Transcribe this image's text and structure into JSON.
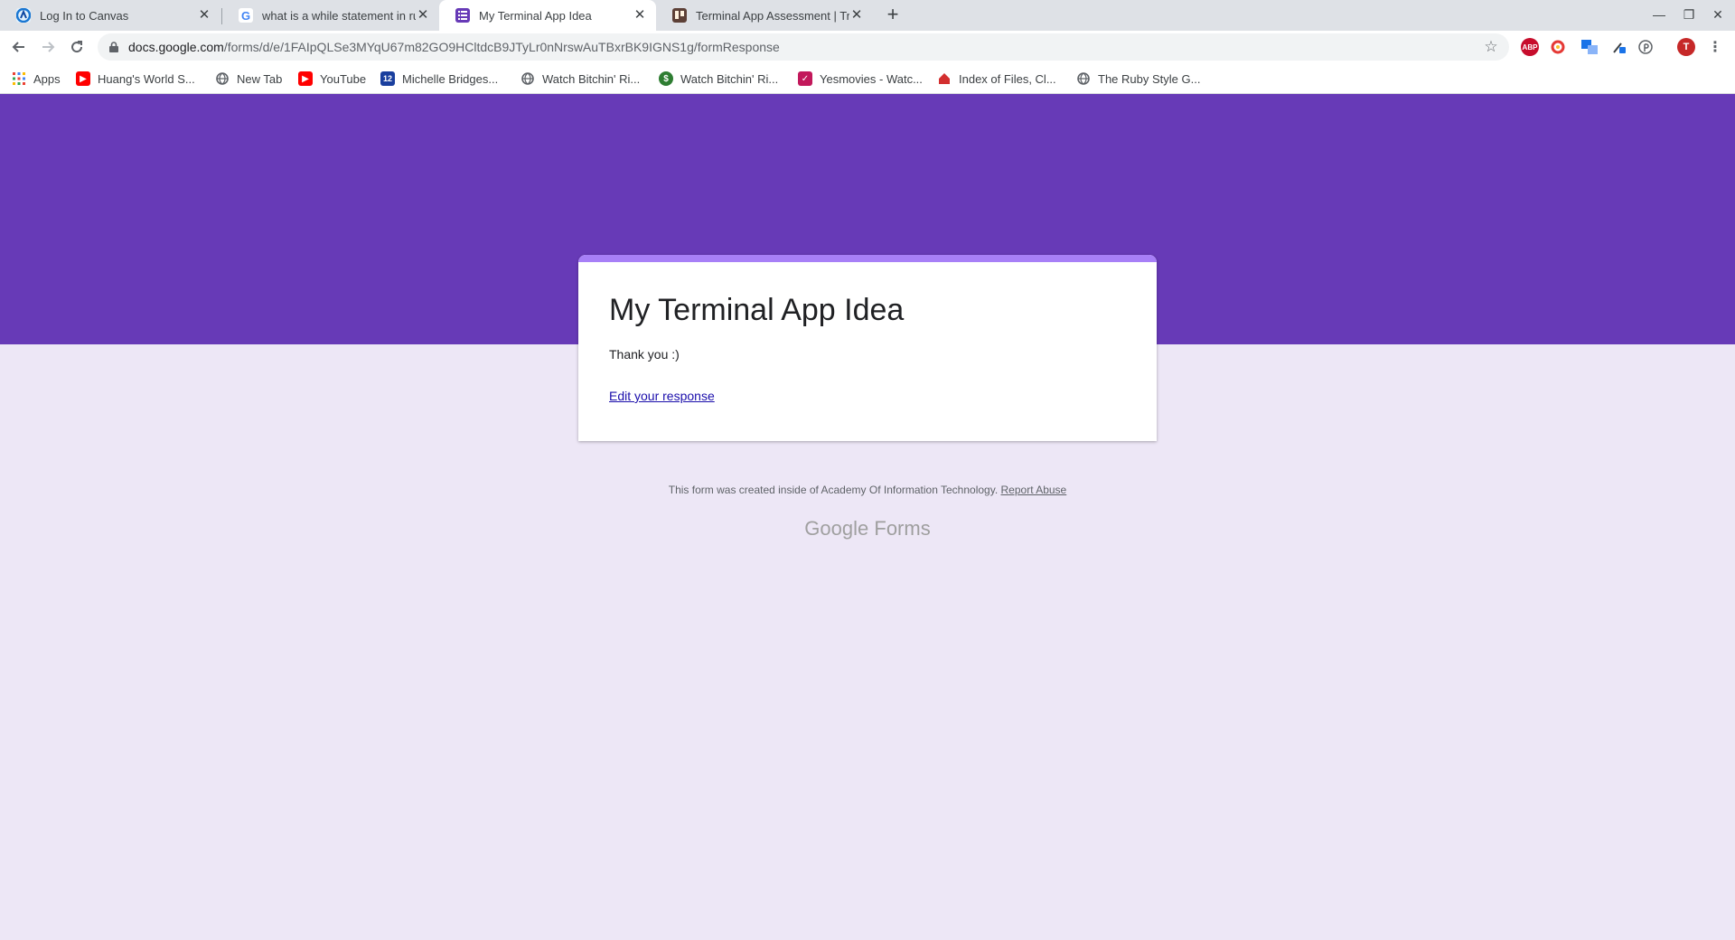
{
  "browser": {
    "tabs": [
      {
        "title": "Log In to Canvas",
        "icon": "canvas-icon"
      },
      {
        "title": "what is a while statement in ru",
        "icon": "google-icon"
      },
      {
        "title": "My Terminal App Idea",
        "icon": "google-forms-icon"
      },
      {
        "title": "Terminal App Assessment | Tr",
        "icon": "trello-icon"
      }
    ],
    "url": {
      "host": "docs.google.com",
      "path": "/forms/d/e/1FAIpQLSe3MYqU67m82GO9HCltdcB9JTyLr0nNrswAuTBxrBK9IGNS1g/formResponse"
    },
    "extensions": [
      {
        "name": "adblock-icon",
        "label": "ABP",
        "color": "#c70d2c"
      },
      {
        "name": "extension-red-icon",
        "label": "",
        "color": "#e53935"
      },
      {
        "name": "extension-translate-icon",
        "label": "",
        "color": "#1a73e8"
      },
      {
        "name": "extension-tool-icon",
        "label": "",
        "color": "#1a73e8"
      },
      {
        "name": "pinterest-icon",
        "label": "",
        "color": "#5f6368"
      }
    ],
    "profile_initial": "T",
    "bookmarks": [
      {
        "label": "Apps",
        "icon": "apps-grid-icon"
      },
      {
        "label": "Huang's World S...",
        "icon": "youtube-icon"
      },
      {
        "label": "New Tab",
        "icon": "globe-icon"
      },
      {
        "label": "YouTube",
        "icon": "youtube-icon"
      },
      {
        "label": "Michelle Bridges...",
        "icon": "calendar-icon",
        "badge": "12"
      },
      {
        "label": "Watch Bitchin' Ri...",
        "icon": "globe-icon"
      },
      {
        "label": "Watch Bitchin' Ri...",
        "icon": "dollar-icon"
      },
      {
        "label": "Yesmovies - Watc...",
        "icon": "yesmovies-icon"
      },
      {
        "label": "Index of Files, Cl...",
        "icon": "house-icon"
      },
      {
        "label": "The Ruby Style G...",
        "icon": "globe-icon"
      }
    ]
  },
  "form": {
    "title": "My Terminal App Idea",
    "confirmation": "Thank you :)",
    "edit_link": "Edit your response"
  },
  "footer": {
    "note": "This form was created inside of Academy Of Information Technology.",
    "report_abuse": "Report Abuse",
    "brand_google": "Google",
    "brand_forms": "Forms"
  },
  "colors": {
    "banner": "#673ab7",
    "accent": "#a77ff7",
    "page_bg": "#ede7f6",
    "link": "#1a0dab"
  }
}
